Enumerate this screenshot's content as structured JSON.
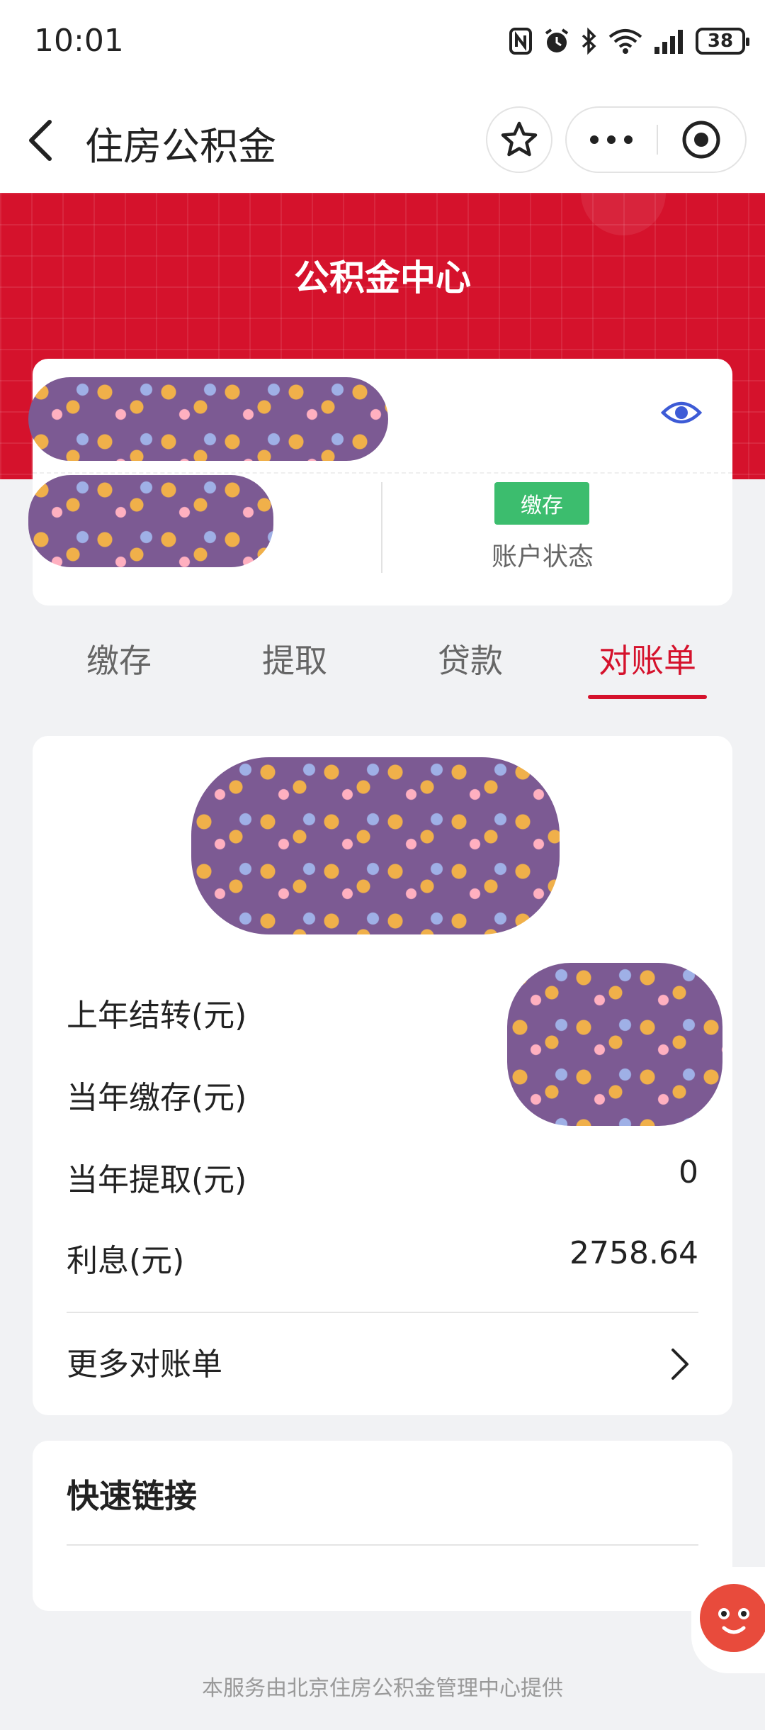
{
  "status_bar": {
    "time": "10:01",
    "battery": "38"
  },
  "nav": {
    "title": "住房公积金"
  },
  "banner": {
    "title": "公积金中心"
  },
  "account": {
    "badge": "缴存",
    "status_label": "账户状态"
  },
  "tabs": [
    {
      "label": "缴存"
    },
    {
      "label": "提取"
    },
    {
      "label": "贷款"
    },
    {
      "label": "对账单",
      "active": true
    }
  ],
  "statement": {
    "rows": [
      {
        "label": "上年结转(元)",
        "value": ""
      },
      {
        "label": "当年缴存(元)",
        "value": ""
      },
      {
        "label": "当年提取(元)",
        "value": "0"
      },
      {
        "label": "利息(元)",
        "value": "2758.64"
      }
    ],
    "more_label": "更多对账单"
  },
  "quick_links": {
    "title": "快速链接"
  },
  "footer": {
    "text": "本服务由北京住房公积金管理中心提供"
  },
  "colors": {
    "brand_red": "#d5122c",
    "badge_green": "#3cbd6e",
    "eye_blue": "#3d5bd6",
    "redaction_purple": "#7c5a93"
  }
}
